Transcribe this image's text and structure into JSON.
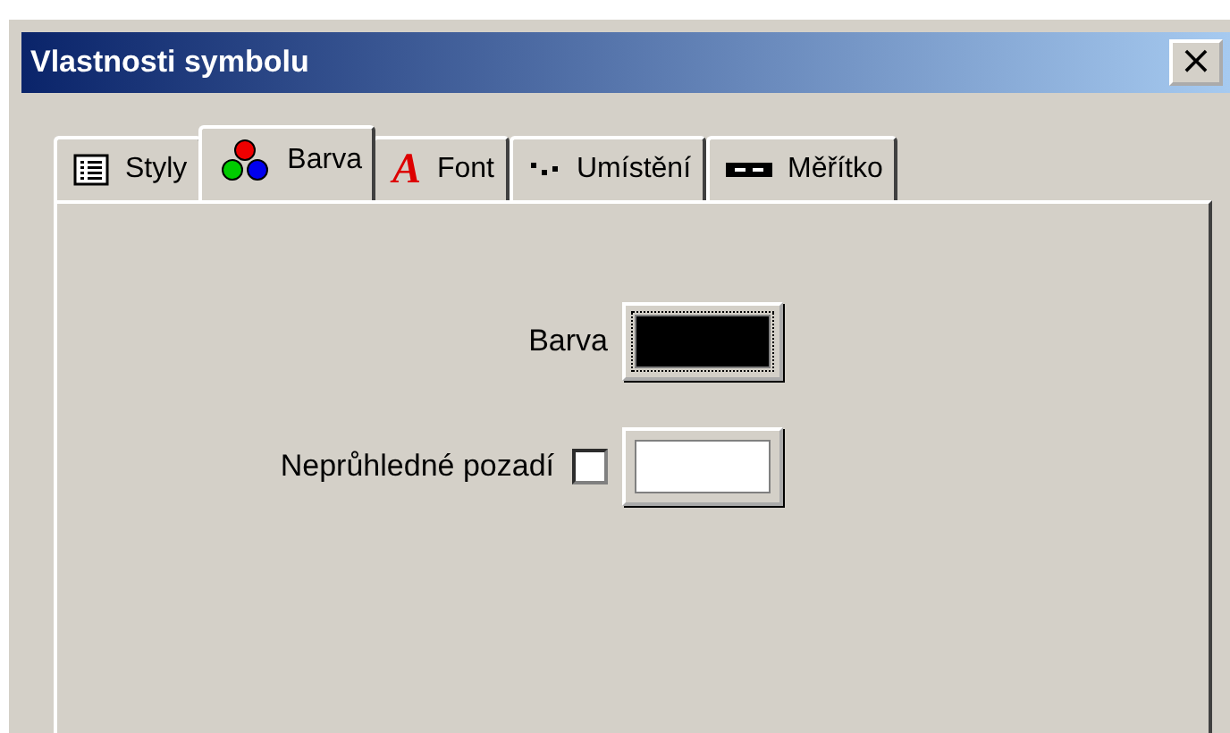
{
  "window": {
    "title": "Vlastnosti symbolu",
    "close": "×"
  },
  "tabs": [
    {
      "label": "Styly",
      "kind": "list",
      "selected": false
    },
    {
      "label": "Barva",
      "kind": "dots",
      "selected": true
    },
    {
      "label": "Font",
      "kind": "letter",
      "icon_text": "A",
      "selected": false
    },
    {
      "label": "Umístění",
      "kind": "scatter",
      "selected": false
    },
    {
      "label": "Měřítko",
      "kind": "scale",
      "selected": false
    }
  ],
  "fields": [
    {
      "label": "Barva",
      "color": "#000000",
      "has_checkbox": false
    },
    {
      "label": "Neprůhledné pozadí",
      "color": "#ffffff",
      "has_checkbox": true,
      "checked": false
    }
  ]
}
